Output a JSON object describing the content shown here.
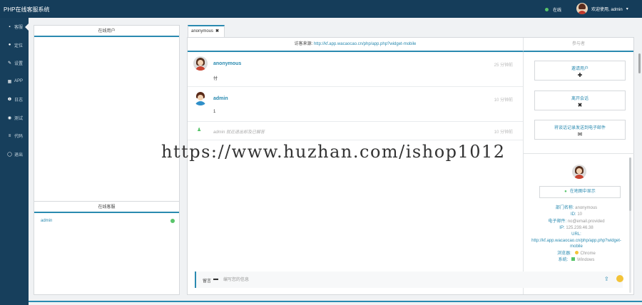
{
  "app": {
    "title": "PHP在线客服系统"
  },
  "topbar": {
    "status_label": "在线",
    "welcome": "欢迎使用, admin",
    "chevron": "▾"
  },
  "sidebar": {
    "items": [
      {
        "icon": "chat-icon",
        "glyph": "▪",
        "label": "客服"
      },
      {
        "icon": "map-pin-icon",
        "glyph": "●",
        "label": "定位"
      },
      {
        "icon": "wrench-icon",
        "glyph": "✎",
        "label": "设置"
      },
      {
        "icon": "qrcode-icon",
        "glyph": "▦",
        "label": "APP"
      },
      {
        "icon": "info-icon",
        "glyph": "❶",
        "label": "日志"
      },
      {
        "icon": "eye-icon",
        "glyph": "◉",
        "label": "测试"
      },
      {
        "icon": "list-icon",
        "glyph": "≡",
        "label": "代码"
      },
      {
        "icon": "power-icon",
        "glyph": "◯",
        "label": "退出"
      }
    ]
  },
  "online_users": {
    "title": "在线用户"
  },
  "online_agents": {
    "title": "在线客服",
    "agents": [
      {
        "name": "admin"
      }
    ]
  },
  "tabs": [
    {
      "label": "anonymous",
      "close": "✖"
    }
  ],
  "chat": {
    "source_label": "访客来源: ",
    "source_url": "http://kf.app.wacaocao.cn/php/app.php?widget-mobile",
    "side_title": "参与者",
    "messages": [
      {
        "name": "anonymous",
        "body": "付",
        "time": "25 分钟前"
      },
      {
        "name": "admin",
        "body": "1",
        "time": "10 分钟前"
      }
    ],
    "system": {
      "note": "admin 就近退出却及已解答",
      "time": "10 分钟前"
    }
  },
  "actions": {
    "invite": {
      "label": "邀请用户",
      "glyph": "✚"
    },
    "leave": {
      "label": "离开会话",
      "glyph": "✖"
    },
    "email": {
      "label": "将谈话记录发送到电子邮件",
      "glyph": "✉"
    }
  },
  "visitor": {
    "map_button": "在地图中显示",
    "fields": [
      {
        "k": "部门名称: ",
        "v": "anonymous"
      },
      {
        "k": "ID: ",
        "v": "10"
      },
      {
        "k": "电子邮件: ",
        "v": "no@email.provided"
      },
      {
        "k": "IP: ",
        "v": "125.239.46.38"
      },
      {
        "k": "URL: ",
        "v": ""
      },
      {
        "k": "",
        "v": "http://kf.app.wacaocao.cn/php/app.php?widget-mobile"
      },
      {
        "k": "浏览器: ",
        "v": "Chrome"
      },
      {
        "k": "系统: ",
        "v": "Windows"
      }
    ]
  },
  "composer": {
    "label": "留言",
    "placeholder": "编写您的信息"
  },
  "watermark": "https://www.huzhan.com/ishop1012",
  "colors": {
    "topbar": "#153d5a",
    "accent": "#2a8ab0",
    "online": "#58c46a"
  }
}
